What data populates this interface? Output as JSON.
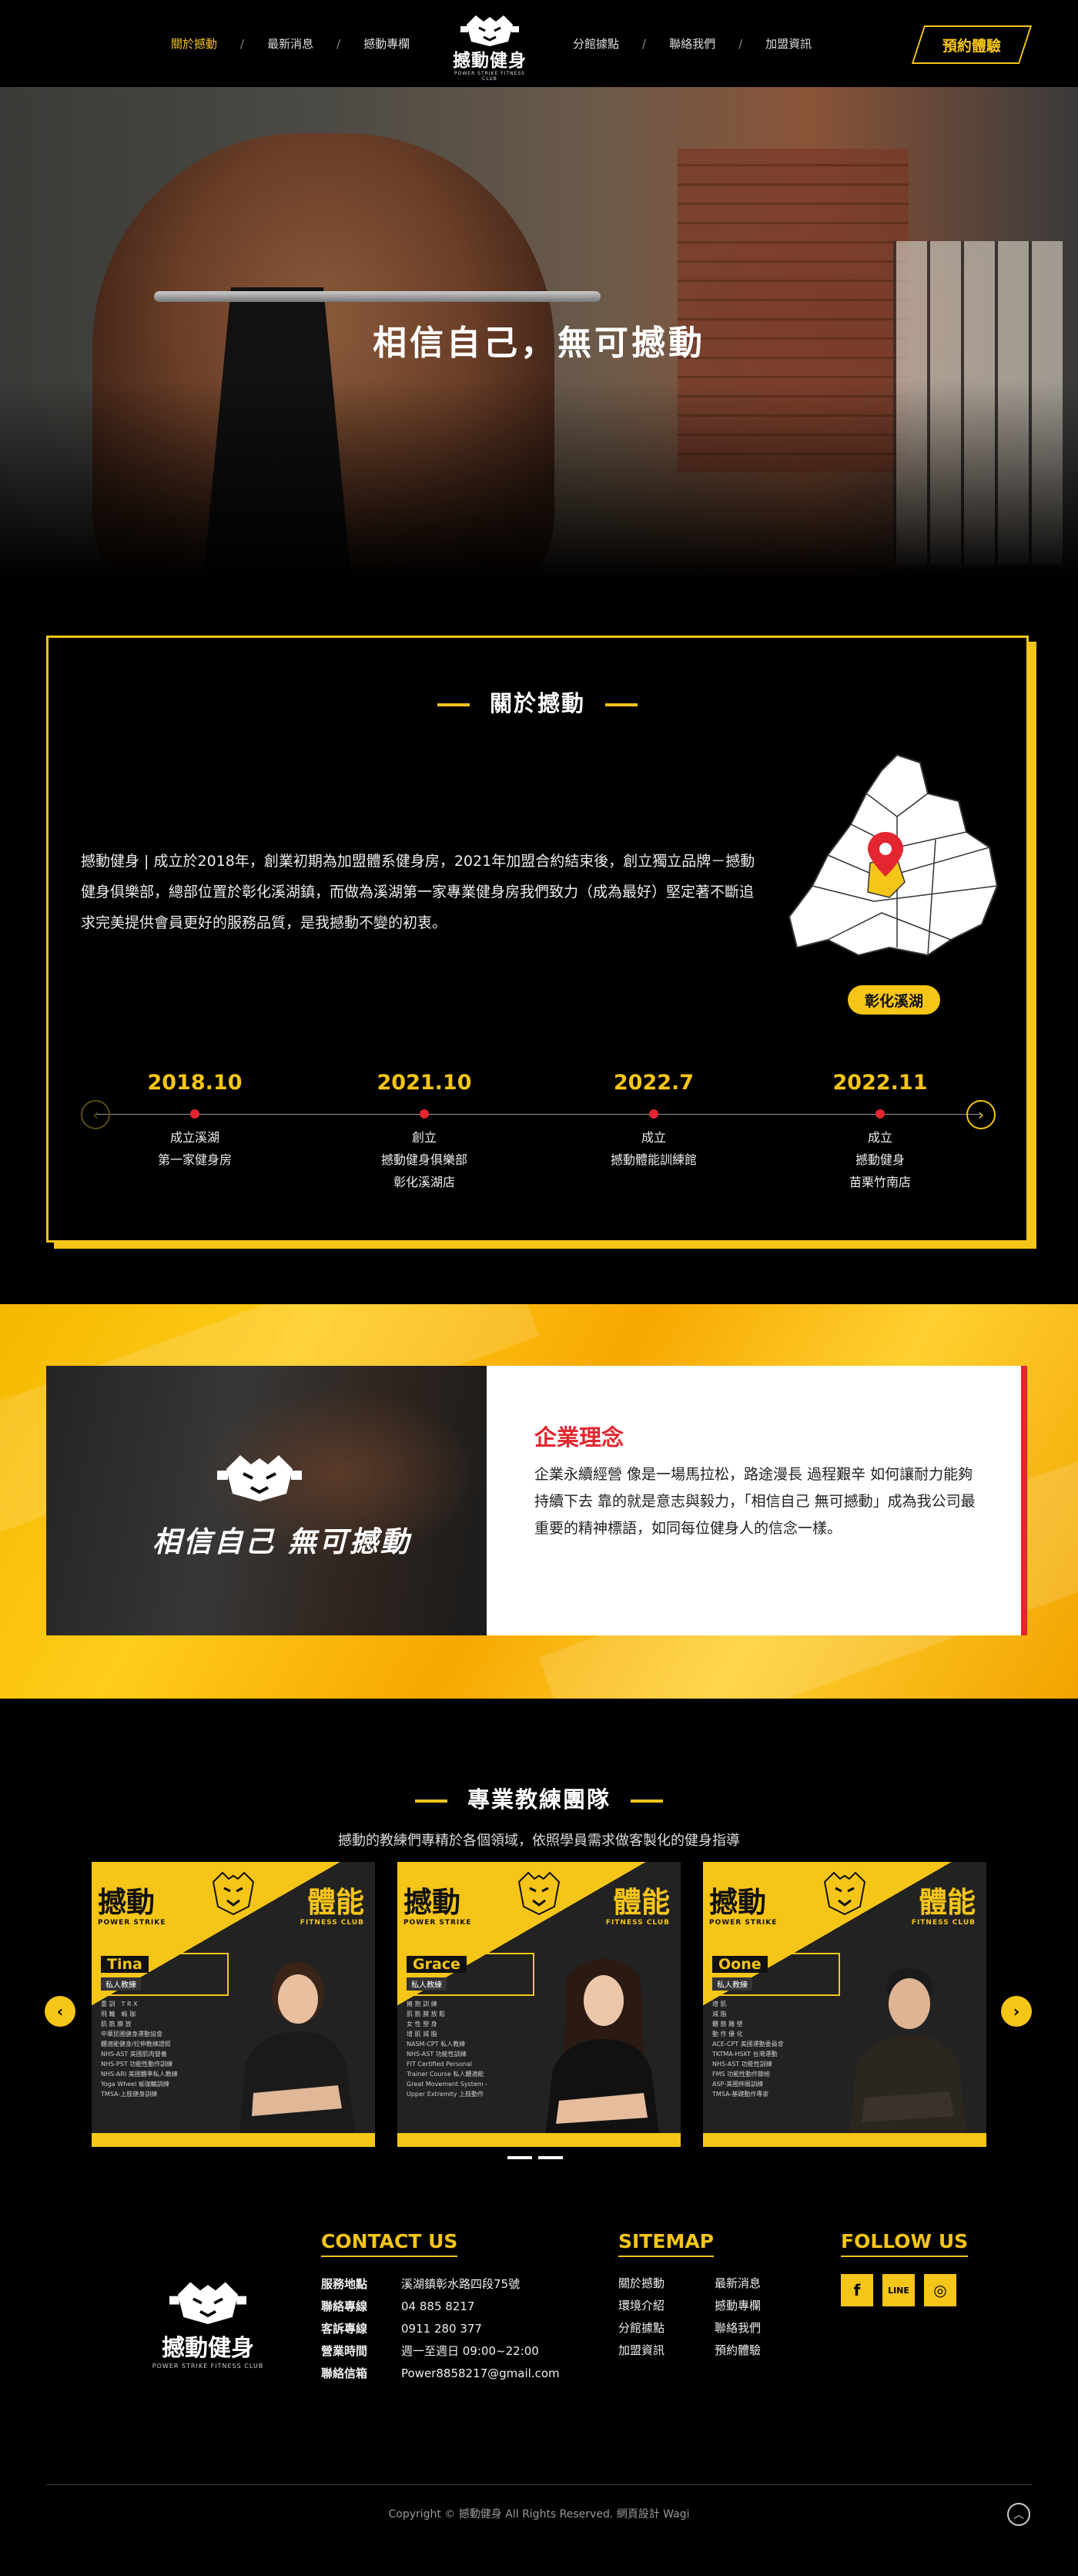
{
  "nav": {
    "left": [
      "關於撼動",
      "最新消息",
      "撼動專欄"
    ],
    "right": [
      "分館據點",
      "聯絡我們",
      "加盟資訊"
    ],
    "separator": "/",
    "brand": "撼動健身",
    "brand_sub": "POWER STRIKE FITNESS CLUB",
    "book_label": "預約體驗"
  },
  "hero": {
    "slogan": "相信自己，無可撼動"
  },
  "about": {
    "title": "關於撼動",
    "text": "撼動健身 | 成立於2018年，創業初期為加盟體系健身房，2021年加盟合約結束後，創立獨立品牌－撼動健身俱樂部，總部位置於彰化溪湖鎮，而做為溪湖第一家專業健身房我們致力（成為最好）堅定著不斷追求完美提供會員更好的服務品質，是我撼動不變的初衷。",
    "map_label": "彰化溪湖",
    "timeline": [
      {
        "date": "2018.10",
        "desc": "成立溪湖\n第一家健身房"
      },
      {
        "date": "2021.10",
        "desc": "創立\n撼動健身俱樂部\n彰化溪湖店"
      },
      {
        "date": "2022.7",
        "desc": "成立\n撼動體能訓練館"
      },
      {
        "date": "2022.11",
        "desc": "成立\n撼動健身\n苗栗竹南店"
      }
    ]
  },
  "philosophy": {
    "motto": "相信自己 無可撼動",
    "title": "企業理念",
    "text": "企業永續經營 像是一場馬拉松，路途漫長 過程艱辛 如何讓耐力能夠持續下去 靠的就是意志與毅力，「相信自己 無可撼動」成為我公司最重要的精神標語，如同每位健身人的信念一樣。"
  },
  "coaches": {
    "title": "專業教練團隊",
    "subtitle": "撼動的教練們專精於各個領域，依照學員需求做客製化的健身指導",
    "card_head": "撼動",
    "card_head2": "體能",
    "card_sub": "POWER STRIKE",
    "card_sub2": "FITNESS CLUB",
    "list": [
      {
        "name": "Tina",
        "role": "私人教練",
        "skills": [
          "重 訓　T R X",
          "飛 輪　瑜 珈",
          "肌 筋 膜 放",
          "中華民國健身運動協會",
          "體適能健身/拉伸教練證照",
          "NHS-AST 美國肌肉營養",
          "NHS-PST 功能性動作訓練",
          "NHS-ARI 美國體準私人教練",
          "Yoga Wheel 瑜珈輪訓練",
          "TMSA-上肢健身訓練"
        ]
      },
      {
        "name": "Grace",
        "role": "私人教練",
        "skills": [
          "擁 抱 訓 練",
          "肌 筋 膜 放 鬆",
          "女 性 塑 身",
          "增 肌 減 脂",
          "NASM-CPT 私人教練",
          "NHS-AST 功能性訓練",
          "FIT Certified Personal",
          "Trainer Course 私人體適能",
          "Great Movement System -",
          "Upper Extremity 上肢動作"
        ]
      },
      {
        "name": "Oone",
        "role": "私人教練",
        "skills": [
          "增 肌",
          "減 脂",
          "體 態 雕 塑",
          "動 作 優 化",
          "ACE-CPT 美國運動委員會",
          "TKTMA-HSKT 台灣運動",
          "NHS-AST 功能性訓練",
          "FMS 功能性動作篩檢",
          "ASP-美國伸展訓練",
          "TMSA-基礎動作專家"
        ]
      }
    ]
  },
  "footer": {
    "brand": "撼動健身",
    "brand_sub": "POWER STRIKE FITNESS CLUB",
    "contact_title": "CONTACT US",
    "contact": [
      {
        "k": "服務地點",
        "v": "溪湖鎮彰水路四段75號"
      },
      {
        "k": "聯絡專線",
        "v": "04 885 8217"
      },
      {
        "k": "客訴專線",
        "v": "0911 280 377"
      },
      {
        "k": "營業時間",
        "v": "週一至週日 09:00~22:00"
      },
      {
        "k": "聯絡信箱",
        "v": "Power8858217@gmail.com"
      }
    ],
    "sitemap_title": "SITEMAP",
    "sitemap": [
      "關於撼動",
      "最新消息",
      "環境介紹",
      "撼動專欄",
      "分館據點",
      "聯絡我們",
      "加盟資訊",
      "預約體驗"
    ],
    "follow_title": "FOLLOW US",
    "social": [
      "f",
      "LINE",
      "◎"
    ],
    "copyright": "Copyright © 撼動健身 All Rights Reserved. 網頁設計 Wagi"
  },
  "colors": {
    "accent": "#f5c518",
    "red": "#e3262f",
    "bg": "#000000"
  }
}
